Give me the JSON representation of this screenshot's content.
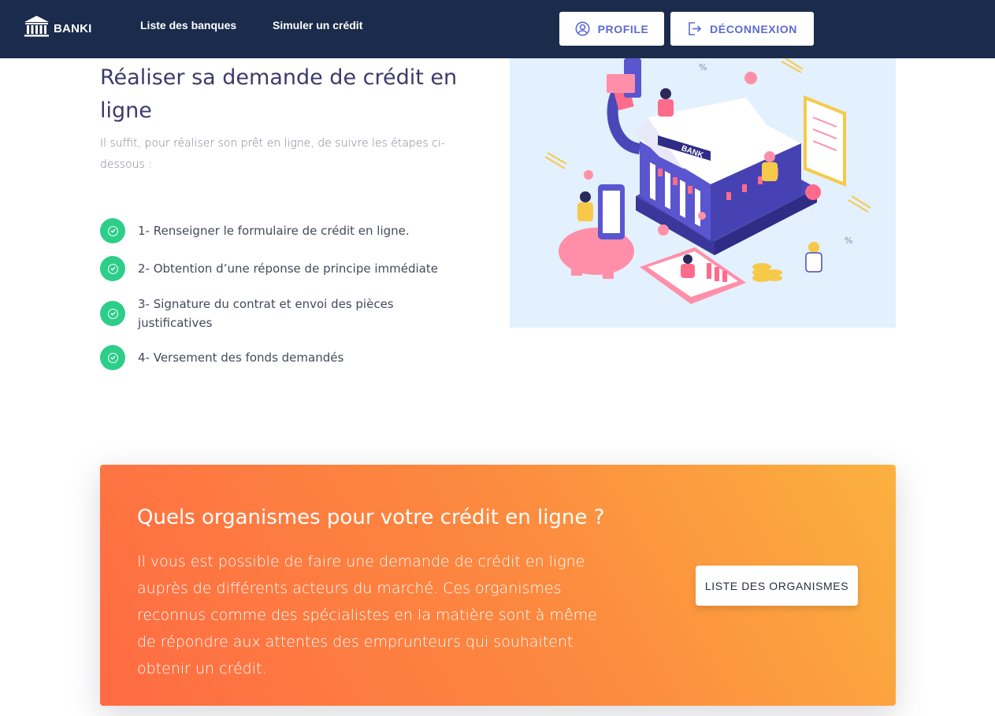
{
  "navbar": {
    "logo_text": "BANKI",
    "logo_icon": "bank-building-icon",
    "links": [
      "Liste des banques",
      "Simuler un crédit"
    ],
    "profile_label": "PROFILE",
    "profile_icon": "user-circle-icon",
    "logout_label": "DÉCONNEXION",
    "logout_icon": "sign-out-icon"
  },
  "hero": {
    "title": "Réaliser sa demande de crédit en ligne",
    "subtitle": "Il suffit, pour réaliser son prêt en ligne, de suivre les étapes ci-dessous :",
    "steps": [
      "1- Renseigner le formulaire de crédit en ligne.",
      "2- Obtention d’une réponse de principe immédiate",
      "3- Signature du contrat et envoi des pièces justificatives",
      "4- Versement des fonds demandés"
    ],
    "illustration_label": "BANK"
  },
  "cta": {
    "title": "Quels organismes pour votre crédit en ligne ?",
    "text": "Il vous est possible de faire une demande de crédit en ligne auprès de différents acteurs du marché. Ces organismes reconnus comme des spécialistes en la matière sont à même de répondre aux attentes des emprunteurs qui souhaitent obtenir un crédit.",
    "button_label": "LISTE DES ORGANISMES"
  },
  "colors": {
    "navbar_bg": "#1a2b4b",
    "accent": "#5b6bd1",
    "check_green": "#2dce89",
    "cta_gradient_start": "#ff6b43",
    "cta_gradient_end": "#fbb13f"
  }
}
